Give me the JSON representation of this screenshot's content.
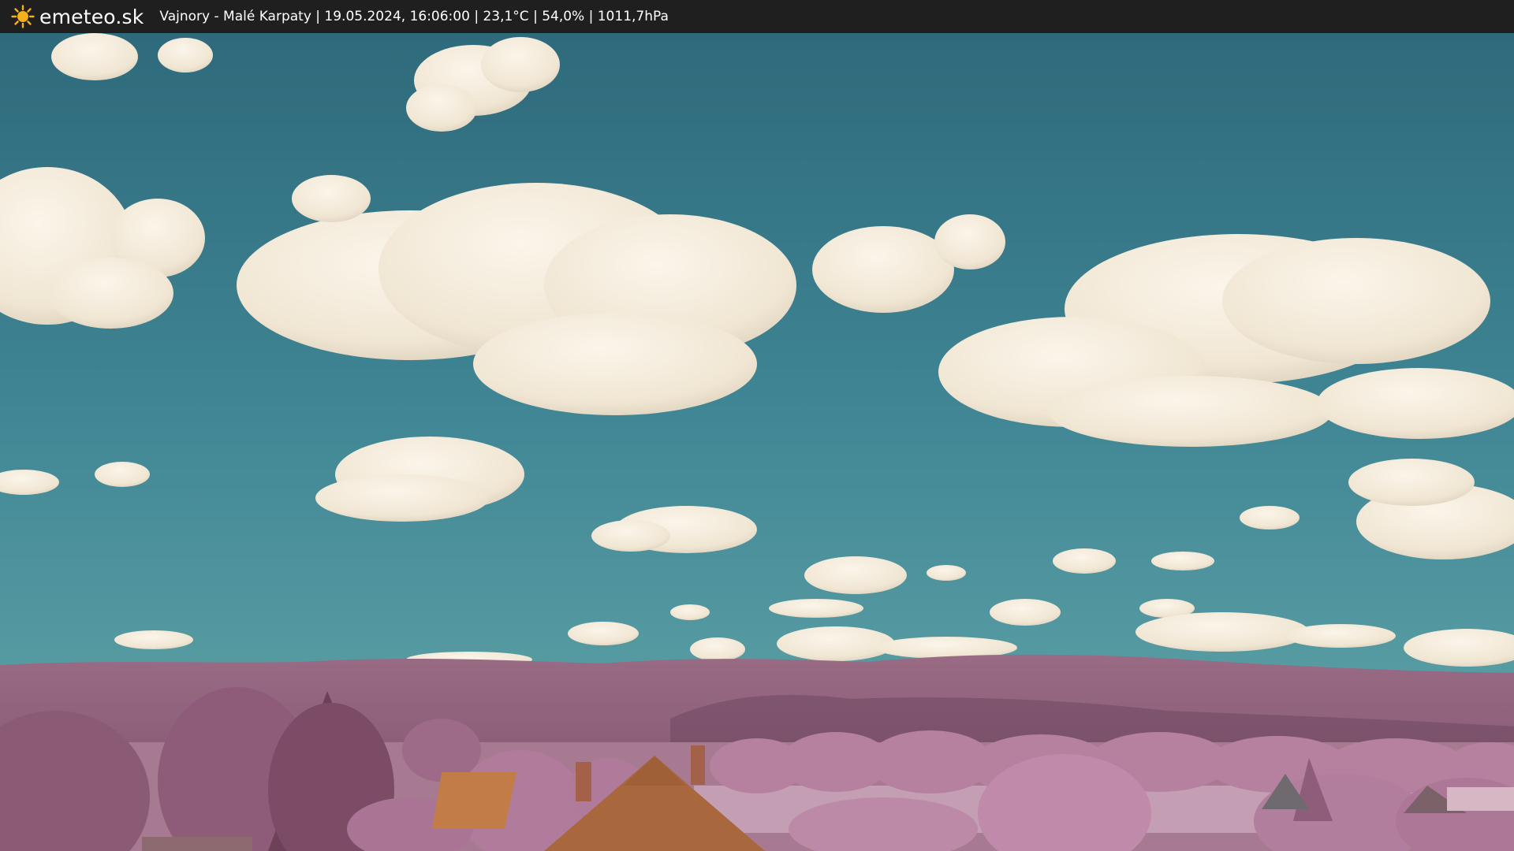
{
  "header": {
    "logo_icon": "sun-icon",
    "brand": "emeteo.sk",
    "caption": "Vajnory - Malé Karpaty | 19.05.2024, 16:06:00 | 23,1°C | 54,0% | 1011,7hPa"
  },
  "colors": {
    "bar": "#1f1f1f",
    "sun": "#f6b11a",
    "sky_top": "#2e6a7b",
    "sky_bottom": "#5ba3a8",
    "cloud": "#f3ead9",
    "hills": "#8c5f77",
    "foliage": "#b07a98",
    "roof": "#b06d3f"
  }
}
